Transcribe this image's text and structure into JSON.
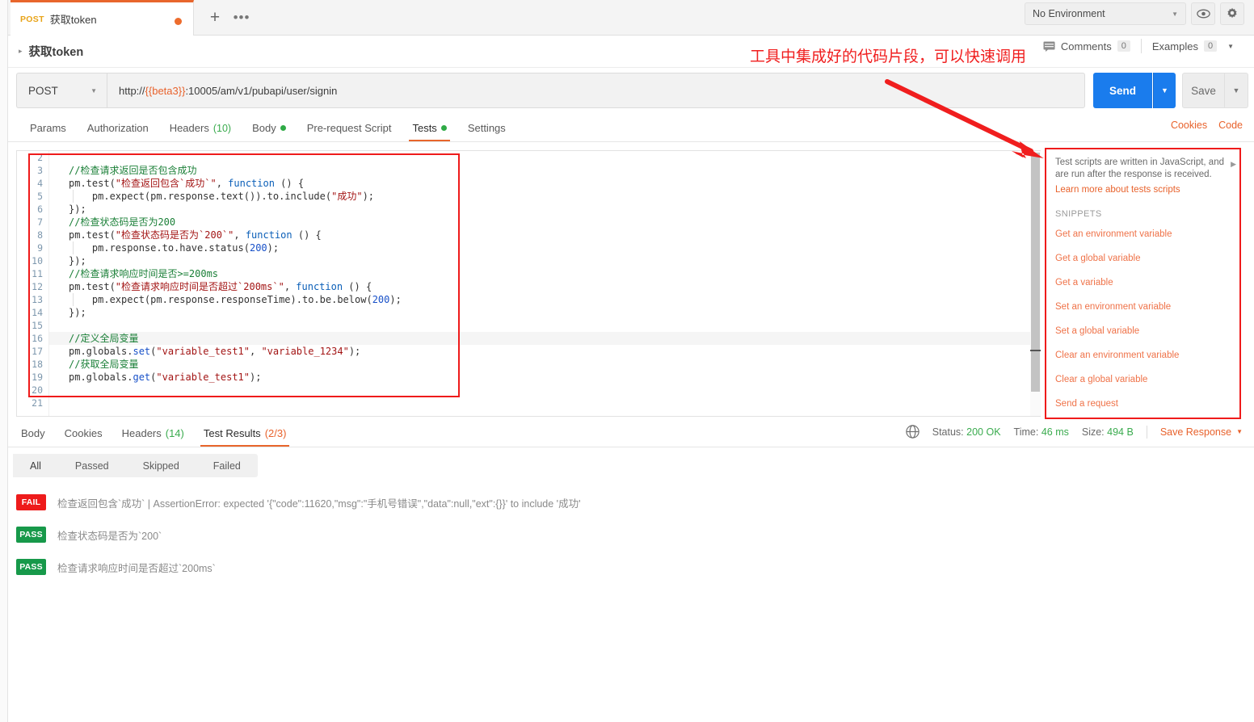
{
  "tab": {
    "method": "POST",
    "name": "获取token",
    "add_label": "+",
    "more_label": "•••"
  },
  "environment": {
    "selected": "No Environment",
    "caret": "▼",
    "eye_icon": "eye-icon",
    "gear_icon": "gear-icon"
  },
  "breadcrumb": {
    "arrow": "▸",
    "title": "获取token"
  },
  "header_right": {
    "comments_label": "Comments",
    "comments_count": "0",
    "examples_label": "Examples",
    "examples_count": "0",
    "examples_caret": "▼"
  },
  "request": {
    "method": "POST",
    "method_caret": "▼",
    "url_prefix": "http://",
    "url_var": "{{beta3}}",
    "url_suffix": ":10005/am/v1/pubapi/user/signin",
    "send_label": "Send",
    "send_caret": "▼",
    "save_label": "Save",
    "save_caret": "▼"
  },
  "request_tabs": [
    {
      "label": "Params",
      "active": false,
      "count": "",
      "dot": false
    },
    {
      "label": "Authorization",
      "active": false,
      "count": "",
      "dot": false
    },
    {
      "label": "Headers",
      "active": false,
      "count": "(10)",
      "dot": false
    },
    {
      "label": "Body",
      "active": false,
      "count": "",
      "dot": true
    },
    {
      "label": "Pre-request Script",
      "active": false,
      "count": "",
      "dot": false
    },
    {
      "label": "Tests",
      "active": true,
      "count": "",
      "dot": true
    },
    {
      "label": "Settings",
      "active": false,
      "count": "",
      "dot": false
    }
  ],
  "right_links": {
    "cookies": "Cookies",
    "code": "Code"
  },
  "annotation": {
    "text": "工具中集成好的代码片段，可以快速调用",
    "color": "#f01e1e"
  },
  "editor": {
    "first_line_number": 2,
    "last_line_number": 21,
    "active_line": 16,
    "lines": [
      {
        "n": 2,
        "segs": []
      },
      {
        "n": 3,
        "segs": [
          {
            "t": "//检查请求返回是否包含成功",
            "c": "cmt"
          }
        ]
      },
      {
        "n": 4,
        "segs": [
          {
            "t": "pm.test(",
            "c": ""
          },
          {
            "t": "\"检查返回包含`成功`\"",
            "c": "str"
          },
          {
            "t": ", ",
            "c": ""
          },
          {
            "t": "function",
            "c": "kw"
          },
          {
            "t": " () {",
            "c": ""
          }
        ]
      },
      {
        "n": 5,
        "segs": [
          {
            "t": "    pm.expect(pm.response.text()).to.include(",
            "c": ""
          },
          {
            "t": "\"成功\"",
            "c": "str"
          },
          {
            "t": ");",
            "c": ""
          }
        ]
      },
      {
        "n": 6,
        "segs": [
          {
            "t": "});",
            "c": ""
          }
        ]
      },
      {
        "n": 7,
        "segs": [
          {
            "t": "//检查状态码是否为200",
            "c": "cmt"
          }
        ]
      },
      {
        "n": 8,
        "segs": [
          {
            "t": "pm.test(",
            "c": ""
          },
          {
            "t": "\"检查状态码是否为`200`\"",
            "c": "str"
          },
          {
            "t": ", ",
            "c": ""
          },
          {
            "t": "function",
            "c": "kw"
          },
          {
            "t": " () {",
            "c": ""
          }
        ]
      },
      {
        "n": 9,
        "segs": [
          {
            "t": "    pm.response.to.have.status(",
            "c": ""
          },
          {
            "t": "200",
            "c": "num2"
          },
          {
            "t": ");",
            "c": ""
          }
        ]
      },
      {
        "n": 10,
        "segs": [
          {
            "t": "});",
            "c": ""
          }
        ]
      },
      {
        "n": 11,
        "segs": [
          {
            "t": "//检查请求响应时间是否>=200ms",
            "c": "cmt"
          }
        ]
      },
      {
        "n": 12,
        "segs": [
          {
            "t": "pm.test(",
            "c": ""
          },
          {
            "t": "\"检查请求响应时间是否超过`200ms`\"",
            "c": "str"
          },
          {
            "t": ", ",
            "c": ""
          },
          {
            "t": "function",
            "c": "kw"
          },
          {
            "t": " () {",
            "c": ""
          }
        ]
      },
      {
        "n": 13,
        "segs": [
          {
            "t": "    pm.expect(pm.response.responseTime).to.be.below(",
            "c": ""
          },
          {
            "t": "200",
            "c": "num2"
          },
          {
            "t": ");",
            "c": ""
          }
        ]
      },
      {
        "n": 14,
        "segs": [
          {
            "t": "});",
            "c": ""
          }
        ]
      },
      {
        "n": 15,
        "segs": []
      },
      {
        "n": 16,
        "segs": [
          {
            "t": "//定义全局变量",
            "c": "cmt"
          }
        ]
      },
      {
        "n": 17,
        "segs": [
          {
            "t": "pm.globals.",
            "c": ""
          },
          {
            "t": "set",
            "c": "fn"
          },
          {
            "t": "(",
            "c": ""
          },
          {
            "t": "\"variable_test1\"",
            "c": "str"
          },
          {
            "t": ", ",
            "c": ""
          },
          {
            "t": "\"variable_1234\"",
            "c": "str"
          },
          {
            "t": ");",
            "c": ""
          }
        ]
      },
      {
        "n": 18,
        "segs": [
          {
            "t": "//获取全局变量",
            "c": "cmt"
          }
        ]
      },
      {
        "n": 19,
        "segs": [
          {
            "t": "pm.globals.",
            "c": ""
          },
          {
            "t": "get",
            "c": "fn"
          },
          {
            "t": "(",
            "c": ""
          },
          {
            "t": "\"variable_test1\"",
            "c": "str"
          },
          {
            "t": ");",
            "c": ""
          }
        ]
      },
      {
        "n": 20,
        "segs": []
      },
      {
        "n": 21,
        "segs": []
      }
    ]
  },
  "snippets_panel": {
    "description": "Test scripts are written in JavaScript, and are run after the response is received.",
    "learn_more": "Learn more about tests scripts",
    "section_title": "SNIPPETS",
    "collapse_caret": "▶",
    "items": [
      "Get an environment variable",
      "Get a global variable",
      "Get a variable",
      "Set an environment variable",
      "Set a global variable",
      "Clear an environment variable",
      "Clear a global variable",
      "Send a request"
    ]
  },
  "response_tabs": [
    {
      "label": "Body",
      "count": "",
      "count_color": "",
      "active": false
    },
    {
      "label": "Cookies",
      "count": "",
      "count_color": "",
      "active": false
    },
    {
      "label": "Headers",
      "count": "(14)",
      "count_color": "green",
      "active": false
    },
    {
      "label": "Test Results",
      "count": "(2/3)",
      "count_color": "orange",
      "active": true
    }
  ],
  "status_bar": {
    "globe_icon": "globe-icon",
    "status_label": "Status:",
    "status_value": "200 OK",
    "time_label": "Time:",
    "time_value": "46 ms",
    "size_label": "Size:",
    "size_value": "494 B",
    "save_response": "Save Response",
    "save_response_caret": "▼"
  },
  "result_filters": [
    {
      "label": "All",
      "active": true
    },
    {
      "label": "Passed",
      "active": false
    },
    {
      "label": "Skipped",
      "active": false
    },
    {
      "label": "Failed",
      "active": false
    }
  ],
  "test_results": [
    {
      "status": "FAIL",
      "text": "检查返回包含`成功` | AssertionError: expected '{\"code\":11620,\"msg\":\"手机号错误\",\"data\":null,\"ext\":{}}' to include '成功'"
    },
    {
      "status": "PASS",
      "text": "检查状态码是否为`200`"
    },
    {
      "status": "PASS",
      "text": "检查请求响应时间是否超过`200ms`"
    }
  ],
  "colors": {
    "accent_orange": "#e8662c",
    "send_blue": "#1a7ced",
    "pass_green": "#17994a",
    "fail_red": "#ee1b1b",
    "annotation_red": "#f01e1e"
  }
}
